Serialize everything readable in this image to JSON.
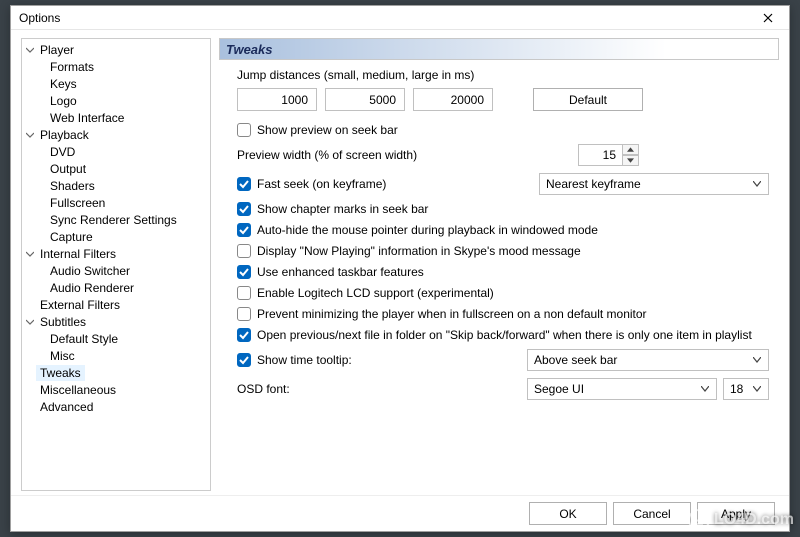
{
  "window": {
    "title": "Options"
  },
  "tree": [
    {
      "label": "Player",
      "top": true
    },
    {
      "label": "Formats"
    },
    {
      "label": "Keys"
    },
    {
      "label": "Logo"
    },
    {
      "label": "Web Interface"
    },
    {
      "label": "Playback",
      "top": true
    },
    {
      "label": "DVD"
    },
    {
      "label": "Output"
    },
    {
      "label": "Shaders"
    },
    {
      "label": "Fullscreen"
    },
    {
      "label": "Sync Renderer Settings"
    },
    {
      "label": "Capture"
    },
    {
      "label": "Internal Filters",
      "top": true
    },
    {
      "label": "Audio Switcher"
    },
    {
      "label": "Audio Renderer"
    },
    {
      "label": "External Filters",
      "top": true,
      "noarrow": true
    },
    {
      "label": "Subtitles",
      "top": true
    },
    {
      "label": "Default Style"
    },
    {
      "label": "Misc"
    },
    {
      "label": "Tweaks",
      "top": true,
      "noarrow": true,
      "selected": true
    },
    {
      "label": "Miscellaneous",
      "top": true,
      "noarrow": true
    },
    {
      "label": "Advanced",
      "top": true,
      "noarrow": true
    }
  ],
  "panel": {
    "title": "Tweaks",
    "jump_label": "Jump distances (small, medium, large in ms)",
    "jump_small": "1000",
    "jump_medium": "5000",
    "jump_large": "20000",
    "default_btn": "Default",
    "show_preview_label": "Show preview on seek bar",
    "show_preview_checked": false,
    "preview_width_label": "Preview width (% of screen width)",
    "preview_width_value": "15",
    "fast_seek_label": "Fast seek (on keyframe)",
    "fast_seek_checked": true,
    "fast_seek_mode": "Nearest keyframe",
    "chapter_marks_label": "Show chapter marks in seek bar",
    "chapter_marks_checked": true,
    "autohide_label": "Auto-hide the mouse pointer during playback in windowed mode",
    "autohide_checked": true,
    "nowplaying_label": "Display \"Now Playing\" information in Skype's mood message",
    "nowplaying_checked": false,
    "taskbar_label": "Use enhanced taskbar features",
    "taskbar_checked": true,
    "logitech_label": "Enable Logitech LCD support (experimental)",
    "logitech_checked": false,
    "prevent_min_label": "Prevent minimizing the player when in fullscreen on a non default monitor",
    "prevent_min_checked": false,
    "open_prev_next_label": "Open previous/next file in folder on \"Skip back/forward\" when there is only one item in playlist",
    "open_prev_next_checked": true,
    "time_tooltip_label": "Show time tooltip:",
    "time_tooltip_checked": true,
    "time_tooltip_value": "Above seek bar",
    "osd_font_label": "OSD font:",
    "osd_font_value": "Segoe UI",
    "osd_font_size": "18"
  },
  "footer": {
    "ok": "OK",
    "cancel": "Cancel",
    "apply": "Apply"
  },
  "watermark": "LO4D.com"
}
